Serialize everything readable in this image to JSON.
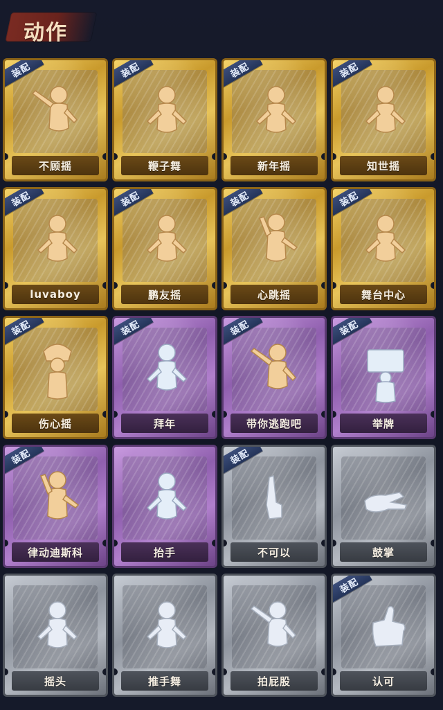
{
  "header": {
    "title": "动作"
  },
  "equip_tag_label": "装配",
  "cards": [
    {
      "label": "不顾摇",
      "tier": "gold",
      "equipped": true,
      "icon": "dancing-figure-pointing-icon"
    },
    {
      "label": "鞭子舞",
      "tier": "gold",
      "equipped": true,
      "icon": "dancing-figure-heart-icon"
    },
    {
      "label": "新年摇",
      "tier": "gold",
      "equipped": true,
      "icon": "dancing-figure-arms-crossed-icon"
    },
    {
      "label": "知世摇",
      "tier": "gold",
      "equipped": true,
      "icon": "dancing-figure-music-icon"
    },
    {
      "label": "luvaboy",
      "tier": "gold",
      "equipped": true,
      "icon": "dancing-figure-arms-folded-icon"
    },
    {
      "label": "鹏友摇",
      "tier": "gold",
      "equipped": true,
      "icon": "dancing-figure-side-arm-icon"
    },
    {
      "label": "心跳摇",
      "tier": "gold",
      "equipped": true,
      "icon": "dancing-figure-raised-hand-icon"
    },
    {
      "label": "舞台中心",
      "tier": "gold",
      "equipped": true,
      "icon": "dancing-figure-hand-chest-icon"
    },
    {
      "label": "伤心摇",
      "tier": "gold",
      "equipped": true,
      "icon": "figure-heart-hands-icon"
    },
    {
      "label": "拜年",
      "tier": "purple",
      "equipped": true,
      "icon": "figure-bowing-icon"
    },
    {
      "label": "带你逃跑吧",
      "tier": "purple",
      "equipped": true,
      "icon": "dancing-figure-pointing-icon"
    },
    {
      "label": "举牌",
      "tier": "purple",
      "equipped": true,
      "icon": "figure-holding-sign-icon"
    },
    {
      "label": "律动迪斯科",
      "tier": "purple",
      "equipped": true,
      "icon": "disco-figure-icon"
    },
    {
      "label": "抬手",
      "tier": "purple",
      "equipped": false,
      "icon": "figure-raising-hand-icon"
    },
    {
      "label": "不可以",
      "tier": "gray",
      "equipped": true,
      "icon": "finger-wag-icon"
    },
    {
      "label": "鼓掌",
      "tier": "gray",
      "equipped": false,
      "icon": "clapping-hands-icon"
    },
    {
      "label": "摇头",
      "tier": "gray",
      "equipped": false,
      "icon": "figure-shaking-head-icon"
    },
    {
      "label": "推手舞",
      "tier": "gray",
      "equipped": false,
      "icon": "figure-push-hands-icon"
    },
    {
      "label": "拍屁股",
      "tier": "gray",
      "equipped": false,
      "icon": "figure-spank-icon"
    },
    {
      "label": "认可",
      "tier": "gray",
      "equipped": true,
      "icon": "thumbs-up-icon"
    }
  ],
  "colors": {
    "gold": "#d9b04a",
    "purple": "#9b6bbd",
    "gray": "#9aa0a8",
    "equip_tag": "#2d3e66",
    "title_brush": "#742923",
    "background": "#141826"
  }
}
